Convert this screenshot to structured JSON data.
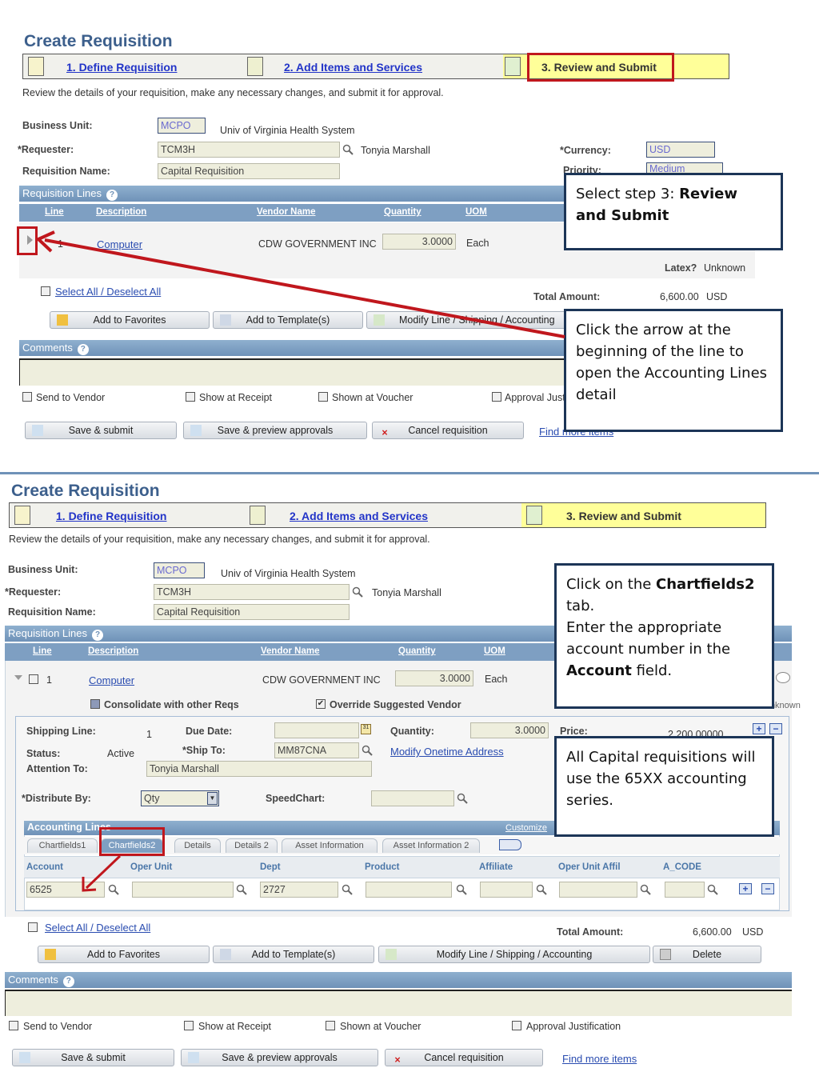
{
  "screen1": {
    "title": "Create Requisition",
    "steps": [
      {
        "label": "1. Define Requisition",
        "icon": "define-document-icon"
      },
      {
        "label": "2. Add Items and Services",
        "icon": "add-items-icon"
      },
      {
        "label": "3. Review and Submit",
        "icon": "review-submit-icon"
      }
    ],
    "instructions": "Review the details of your requisition, make any necessary changes, and submit it for approval.",
    "business_unit": {
      "label": "Business Unit:",
      "value": "MCPO",
      "description": "Univ of Virginia Health System"
    },
    "requester": {
      "label": "*Requester:",
      "value": "TCM3H",
      "name": "Tonyia Marshall"
    },
    "requisition_name": {
      "label": "Requisition Name:",
      "value": "Capital Requisition"
    },
    "currency": {
      "label": "*Currency:",
      "value": "USD"
    },
    "priority": {
      "label": "Priority:",
      "value": "Medium"
    },
    "requisition_lines": {
      "title": "Requisition Lines",
      "columns": [
        "Line",
        "Description",
        "Vendor Name",
        "Quantity",
        "UOM"
      ],
      "row": {
        "line": "1",
        "description": "Computer",
        "vendor": "CDW GOVERNMENT INC",
        "quantity": "3.0000",
        "uom": "Each"
      },
      "latex_label": "Latex?",
      "latex_value": "Unknown"
    },
    "select_all": "Select All / Deselect All",
    "total_label": "Total Amount:",
    "total_value": "6,600.00",
    "total_currency": "USD",
    "line_buttons": [
      "Add to Favorites",
      "Add to Template(s)",
      "Modify Line / Shipping / Accounting"
    ],
    "comments_title": "Comments",
    "comment_checks": [
      "Send to Vendor",
      "Show at Receipt",
      "Shown at Voucher",
      "Approval Justification"
    ],
    "actions": [
      "Save & submit",
      "Save & preview approvals",
      "Cancel requisition"
    ],
    "find_more": "Find more items",
    "callout1": {
      "normal": "Select step 3: ",
      "bold": "Review and Submit"
    },
    "callout2": "Click the arrow at the beginning of the line to open the Accounting Lines detail"
  },
  "screen2": {
    "title": "Create Requisition",
    "steps": [
      {
        "label": "1. Define Requisition"
      },
      {
        "label": "2. Add Items and Services"
      },
      {
        "label": "3. Review and Submit"
      }
    ],
    "instructions": "Review the details of your requisition, make any necessary changes, and submit it for approval.",
    "business_unit": {
      "label": "Business Unit:",
      "value": "MCPO",
      "description": "Univ of Virginia Health System"
    },
    "requester": {
      "label": "*Requester:",
      "value": "TCM3H",
      "name": "Tonyia Marshall"
    },
    "requisition_name": {
      "label": "Requisition Name:",
      "value": "Capital Requisition"
    },
    "requisition_lines": {
      "title": "Requisition Lines",
      "columns": [
        "Line",
        "Description",
        "Vendor Name",
        "Quantity",
        "UOM"
      ],
      "row": {
        "line": "1",
        "description": "Computer",
        "vendor": "CDW GOVERNMENT INC",
        "quantity": "3.0000",
        "uom": "Each"
      },
      "consolidate": "Consolidate with other Reqs",
      "override_vendor": "Override Suggested Vendor",
      "latex_value": "Unknown"
    },
    "shipping": {
      "shipping_line_label": "Shipping Line:",
      "shipping_line": "1",
      "due_date_label": "Due Date:",
      "due_date": "",
      "quantity_label": "Quantity:",
      "quantity": "3.0000",
      "price_label": "Price:",
      "price": "2,200.00000",
      "status_label": "Status:",
      "status": "Active",
      "ship_to_label": "*Ship To:",
      "ship_to": "MM87CNA",
      "modify_address": "Modify Onetime Address",
      "attention_label": "Attention To:",
      "attention": "Tonyia Marshall",
      "distribute_label": "*Distribute By:",
      "distribute": "Qty",
      "speedchart_label": "SpeedChart:",
      "speedchart": ""
    },
    "accounting": {
      "title": "Accounting Lines",
      "customize": "Customize",
      "tabs": [
        "Chartfields1",
        "Chartfields2",
        "Details",
        "Details 2",
        "Asset Information",
        "Asset Information 2"
      ],
      "active_tab": "Chartfields2",
      "columns": [
        "Account",
        "Oper Unit",
        "Dept",
        "Product",
        "Affiliate",
        "Oper Unit Affil",
        "A_CODE"
      ],
      "values": [
        "6525",
        "",
        "2727",
        "",
        "",
        "",
        ""
      ]
    },
    "select_all": "Select All / Deselect All",
    "total_label": "Total Amount:",
    "total_value": "6,600.00",
    "total_currency": "USD",
    "line_buttons": [
      "Add to Favorites",
      "Add to Template(s)",
      "Modify Line / Shipping / Accounting",
      "Delete"
    ],
    "comments_title": "Comments",
    "comment_checks": [
      "Send to Vendor",
      "Show at Receipt",
      "Shown at Voucher",
      "Approval Justification"
    ],
    "actions": [
      "Save & submit",
      "Save & preview approvals",
      "Cancel requisition"
    ],
    "find_more": "Find more items",
    "callout3": {
      "p1": "Click on the ",
      "p1b": "Chartfields2",
      "p2": " tab.",
      "p3": "Enter the appropriate account number in the ",
      "p3b": "Account",
      "p4": " field."
    },
    "callout4": "All Capital requisitions will use the 65XX accounting series."
  },
  "colors": {
    "accent_red": "#c0171d",
    "header_blue": "#6f92b8",
    "title_blue": "#3c5f8c",
    "current_step": "#ffff99"
  }
}
